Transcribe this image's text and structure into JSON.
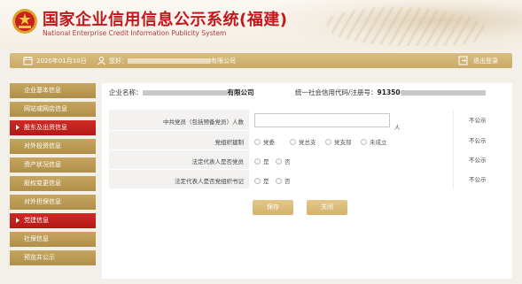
{
  "header": {
    "title_cn": "国家企业信用信息公示系统(福建)",
    "title_en": "National Enterprise Credit Information Publicity System"
  },
  "infobar": {
    "date": "2020年01月10日",
    "greeting_prefix": "您好：",
    "greeting_suffix": "有限公司",
    "logout_label": "退出登录"
  },
  "sidebar": {
    "items": [
      {
        "label": "企业基本信息",
        "active": false
      },
      {
        "label": "网站或网店信息",
        "active": false
      },
      {
        "label": "股东及出资信息",
        "active": true
      },
      {
        "label": "对外投资信息",
        "active": false
      },
      {
        "label": "资产状况信息",
        "active": false
      },
      {
        "label": "股权变更信息",
        "active": false
      },
      {
        "label": "对外担保信息",
        "active": false
      },
      {
        "label": "党建信息",
        "active": true
      },
      {
        "label": "社保信息",
        "active": false
      },
      {
        "label": "预览并公示",
        "active": false
      }
    ]
  },
  "main": {
    "company_label": "企业名称：",
    "company_suffix": "有限公司",
    "credit_code_label": "统一社会信用代码/注册号：",
    "credit_code_prefix": "91350",
    "form": {
      "row1": {
        "label": "中共党员（包括预备党员）人数",
        "input_value": "",
        "unit": "人",
        "side": "不公示"
      },
      "row2": {
        "label": "党组织建制",
        "options": [
          "党委",
          "党总支",
          "党支部",
          "未成立"
        ],
        "side": "不公示"
      },
      "row3": {
        "label": "法定代表人是否党员",
        "options": [
          "是",
          "否"
        ],
        "side": "不公示"
      },
      "row4": {
        "label": "法定代表人是否党组织书记",
        "options": [
          "是",
          "否"
        ],
        "side": "不公示"
      }
    },
    "buttons": {
      "save": "保存",
      "close": "关闭"
    }
  },
  "colors": {
    "brand_red": "#c4171b",
    "gold": "#c6a560",
    "active_red": "#cf2b26"
  }
}
